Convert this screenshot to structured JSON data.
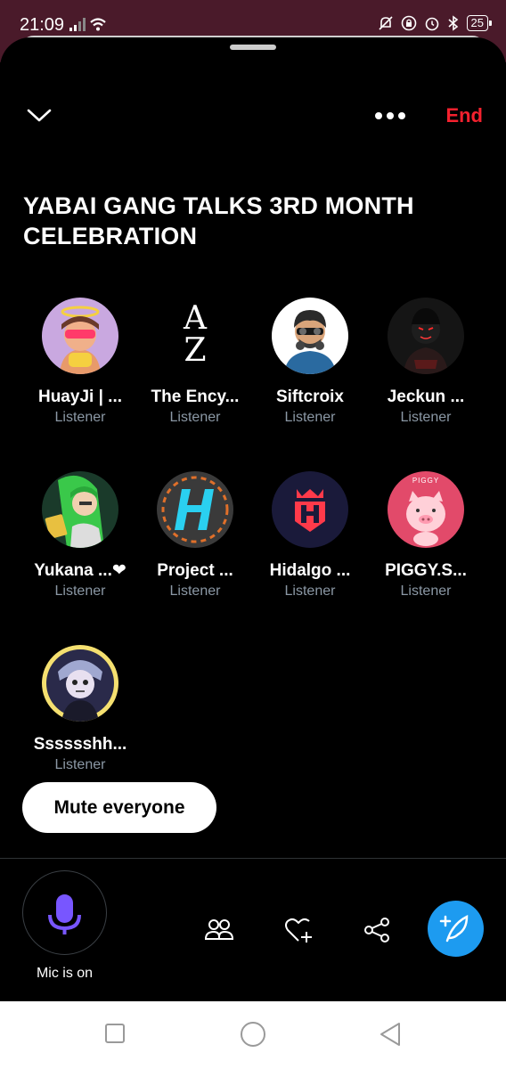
{
  "status_bar": {
    "time": "21:09",
    "battery": "25"
  },
  "space": {
    "title": "YABAI GANG TALKS 3RD MONTH CELEBRATION",
    "end_label": "End"
  },
  "participants": [
    {
      "name": "HuayJi | ...",
      "role": "Listener"
    },
    {
      "name": "The Ency...",
      "role": "Listener"
    },
    {
      "name": "Siftcroix",
      "role": "Listener"
    },
    {
      "name": "Jeckun ...",
      "role": "Listener"
    },
    {
      "name": "Yukana ...❤",
      "role": "Listener"
    },
    {
      "name": "Project ...",
      "role": "Listener"
    },
    {
      "name": "Hidalgo ...",
      "role": "Listener"
    },
    {
      "name": "PIGGY.S...",
      "role": "Listener"
    },
    {
      "name": "Sssssshh...",
      "role": "Listener"
    }
  ],
  "avatar_text": {
    "encyclopedia": "A Z",
    "piggy": "PIGGY"
  },
  "controls": {
    "mute_everyone": "Mute everyone",
    "mic_status": "Mic is on"
  },
  "colors": {
    "accent_blue": "#1d9bf0",
    "end_red": "#f4212e",
    "mic_purple": "#7856ff",
    "status_bar_bg": "#4a1a2a"
  }
}
